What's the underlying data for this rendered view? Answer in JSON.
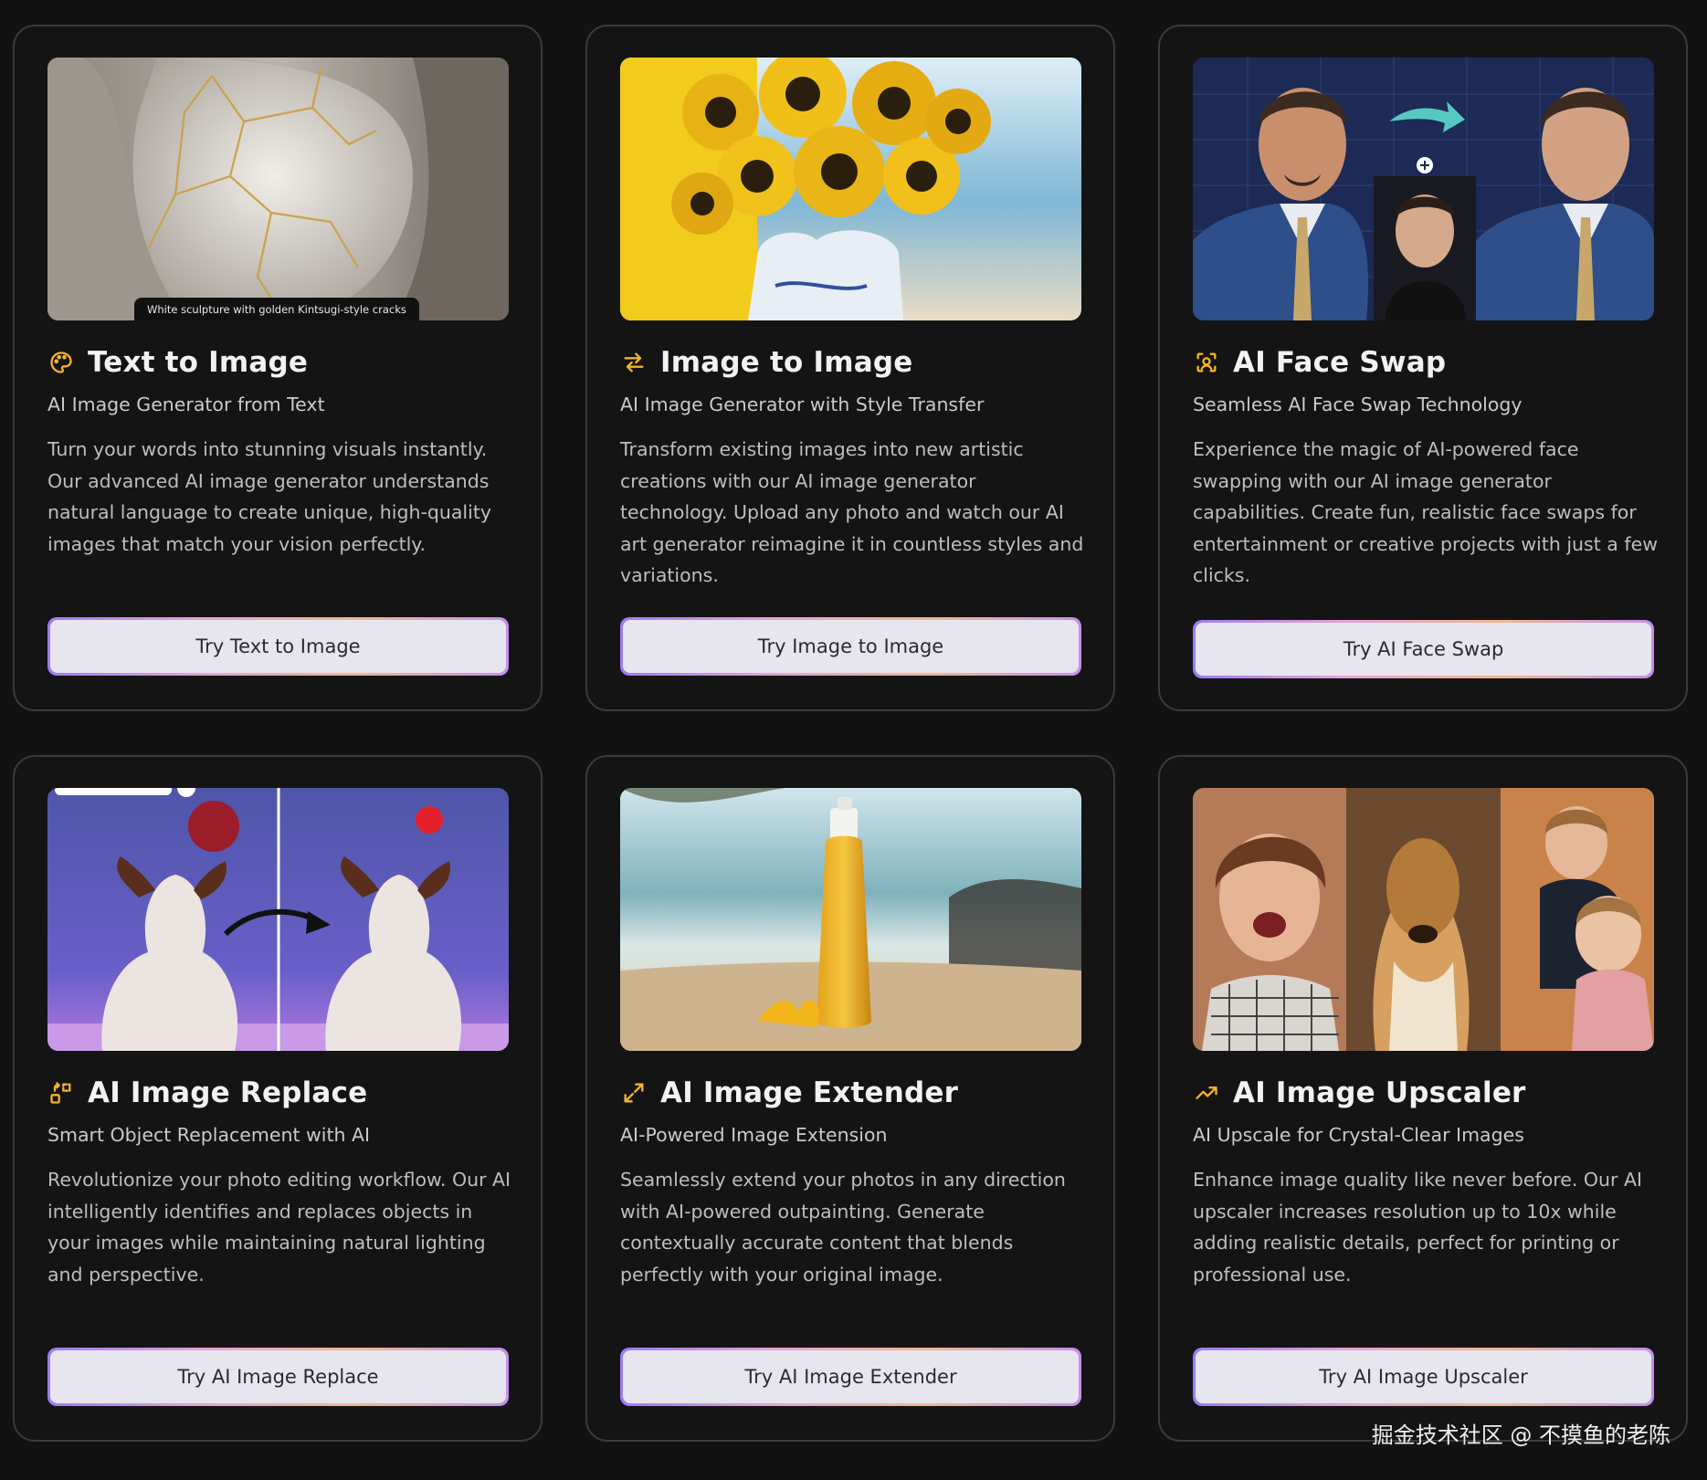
{
  "cards": [
    {
      "icon": "palette-icon",
      "title": "Text to Image",
      "subtitle": "AI Image Generator from Text",
      "description": "Turn your words into stunning visuals instantly. Our advanced AI image generator understands natural language to create unique, high-quality images that match your vision perfectly.",
      "button": "Try Text to Image",
      "image_caption": "White sculpture with golden Kintsugi-style cracks"
    },
    {
      "icon": "arrows-swap-icon",
      "title": "Image to Image",
      "subtitle": "AI Image Generator with Style Transfer",
      "description": "Transform existing images into new artistic creations with our AI image generator technology. Upload any photo and watch our AI art generator reimagine it in countless styles and variations.",
      "button": "Try Image to Image"
    },
    {
      "icon": "face-frame-icon",
      "title": "AI Face Swap",
      "subtitle": "Seamless AI Face Swap Technology",
      "description": "Experience the magic of AI-powered face swapping with our AI image generator capabilities. Create fun, realistic face swaps for entertainment or creative projects with just a few clicks.",
      "button": "Try AI Face Swap"
    },
    {
      "icon": "shapes-replace-icon",
      "title": "AI Image Replace",
      "subtitle": "Smart Object Replacement with AI",
      "description": "Revolutionize your photo editing workflow. Our AI intelligently identifies and replaces objects in your images while maintaining natural lighting and perspective.",
      "button": "Try AI Image Replace"
    },
    {
      "icon": "expand-arrows-icon",
      "title": "AI Image Extender",
      "subtitle": "AI-Powered Image Extension",
      "description": "Seamlessly extend your photos in any direction with AI-powered outpainting. Generate contextually accurate content that blends perfectly with your original image.",
      "button": "Try AI Image Extender"
    },
    {
      "icon": "trending-up-icon",
      "title": "AI Image Upscaler",
      "subtitle": "AI Upscale for Crystal-Clear Images",
      "description": "Enhance image quality like never before. Our AI upscaler increases resolution up to 10x while adding realistic details, perfect for printing or professional use.",
      "button": "Try AI Image Upscaler"
    }
  ],
  "watermark": "掘金技术社区 @ 不摸鱼的老陈",
  "colors": {
    "background": "#121212",
    "card_border": "#3a3a40",
    "accent_icon": "#f5b52a",
    "button_bg": "#e7e6ee"
  }
}
